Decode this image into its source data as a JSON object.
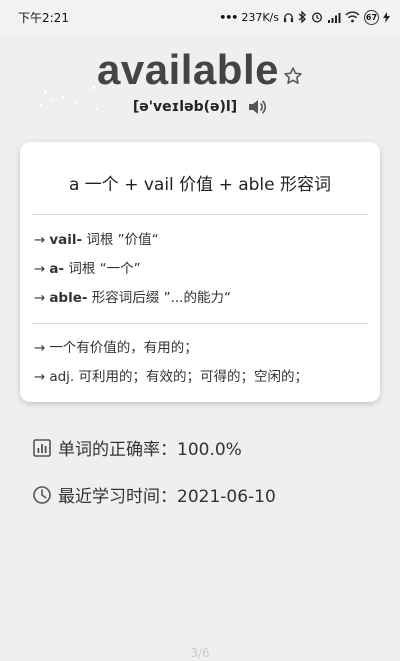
{
  "status_bar": {
    "time": "下午2:21",
    "speed": "237K/s",
    "battery": "67"
  },
  "word": {
    "text": "available",
    "phonetic": "[ə'veɪləb(ə)l]"
  },
  "card": {
    "etymology": "a 一个 + vail 价值 + able 形容词",
    "arrow": "→",
    "roots": [
      {
        "name": "vail-",
        "desc": "词根 ”价值“"
      },
      {
        "name": "a-",
        "desc": "词根 “一个”"
      },
      {
        "name": "able-",
        "desc": "形容词后缀 ”...的能力“"
      }
    ],
    "meanings": [
      "一个有价值的，有用的；",
      "adj. 可利用的；有效的；可得的；空闲的；"
    ]
  },
  "stats": {
    "accuracy_label": "单词的正确率：",
    "accuracy_value": "100.0%",
    "last_study_label": "最近学习时间：",
    "last_study_value": "2021-06-10"
  },
  "pager": "3/6",
  "icons": {
    "star": "star-outline-icon",
    "speaker": "speaker-icon",
    "chart": "chart-icon",
    "clock": "clock-icon"
  }
}
